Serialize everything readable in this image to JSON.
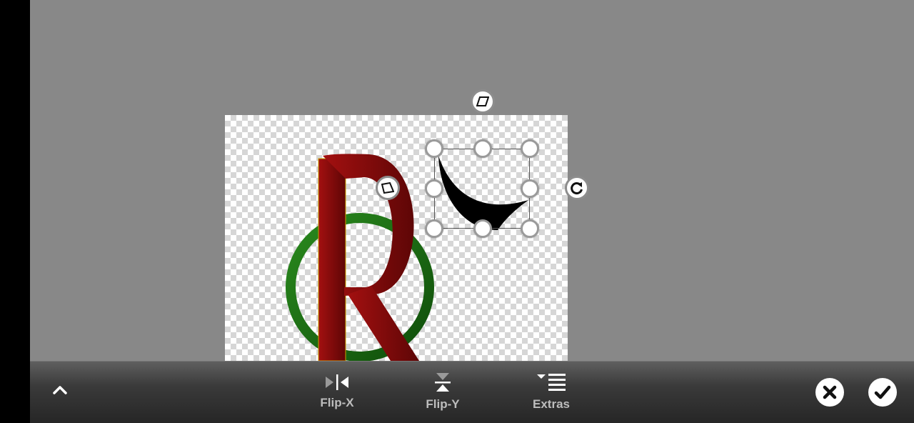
{
  "toolbar": {
    "flip_x_label": "Flip-X",
    "flip_y_label": "Flip-Y",
    "extras_label": "Extras"
  },
  "icons": {
    "collapse": "chevron-up-icon",
    "flip_x": "flip-horizontal-icon",
    "flip_y": "flip-vertical-icon",
    "extras": "list-menu-icon",
    "cancel": "close-icon",
    "confirm": "check-icon",
    "rotate": "rotate-icon",
    "skew": "skew-icon",
    "distort": "distort-icon"
  },
  "colors": {
    "workspace": "#888888",
    "letter_r": "#8b0a0a",
    "ring": "#1a6b12",
    "shape": "#000000",
    "toolbar": "#2e2e2e"
  }
}
